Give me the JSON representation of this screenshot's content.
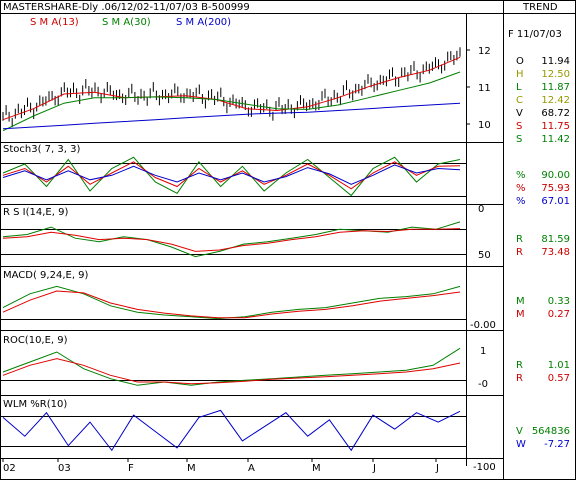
{
  "header": {
    "title": "MASTERSHARE-Dly .06/12/02-11/07/03 B-500999",
    "trend": "TREND",
    "sma13": "S M A(13)",
    "sma30": "S M A(30)",
    "sma200": "S M A(200)"
  },
  "colors": {
    "price": "#000000",
    "sma13": "#e00000",
    "sma30": "#008000",
    "sma200": "#0000cc",
    "grid": "#000000",
    "text_green": "#008000",
    "text_red": "#cc0000",
    "text_olive": "#999900",
    "text_blue": "#0000cc"
  },
  "readout": {
    "date": "F 11/07/03",
    "rows": [
      {
        "k": "O",
        "v": "11.94",
        "color": "#000000"
      },
      {
        "k": "H",
        "v": "12.50",
        "color": "#999900"
      },
      {
        "k": "L",
        "v": "11.87",
        "color": "#008000"
      },
      {
        "k": "C",
        "v": "12.42",
        "color": "#999900"
      },
      {
        "k": "V",
        "v": "68.72",
        "color": "#000000"
      },
      {
        "k": "S",
        "v": "11.75",
        "color": "#cc0000"
      },
      {
        "k": "S",
        "v": "11.42",
        "color": "#008000"
      }
    ]
  },
  "panels": {
    "stoch": {
      "label": "Stoch3( 7, 3, 3)",
      "rows": [
        {
          "k": "%",
          "v": "90.00",
          "color": "#008000"
        },
        {
          "k": "%",
          "v": "75.93",
          "color": "#cc0000"
        },
        {
          "k": "%",
          "v": "67.01",
          "color": "#0000cc"
        }
      ]
    },
    "rsi": {
      "label": "R S I(14,E, 9)",
      "rows": [
        {
          "k": "R",
          "v": "81.59",
          "color": "#008000"
        },
        {
          "k": "R",
          "v": "73.48",
          "color": "#cc0000"
        }
      ]
    },
    "macd": {
      "label": "MACD( 9,24,E, 9)",
      "rows": [
        {
          "k": "M",
          "v": "0.33",
          "color": "#008000"
        },
        {
          "k": "M",
          "v": "0.27",
          "color": "#cc0000"
        }
      ]
    },
    "roc": {
      "label": "ROC(10,E, 9)",
      "rows": [
        {
          "k": "R",
          "v": "1.01",
          "color": "#008000"
        },
        {
          "k": "R",
          "v": "0.57",
          "color": "#cc0000"
        }
      ]
    },
    "wlm": {
      "label": "WLM %R(10)",
      "rows": [
        {
          "k": "V",
          "v": "564836",
          "color": "#008000"
        },
        {
          "k": "W",
          "v": "-7.27",
          "color": "#0000cc"
        }
      ]
    }
  },
  "chart_data": [
    {
      "type": "line",
      "title": "MASTERSHARE-Dly .06/12/02-11/07/03 B-500999",
      "xlabel": "",
      "ylabel": "",
      "x_tick_labels": [
        "02",
        "03",
        "F",
        "M",
        "A",
        "M",
        "J",
        "J"
      ],
      "y_tick_labels": [
        "12",
        "11",
        "10"
      ],
      "ylim": [
        9.7,
        12.7
      ],
      "series": [
        {
          "name": "S M A(13)",
          "x": [
            0,
            10,
            20,
            30,
            40,
            50,
            60,
            70,
            80,
            90,
            100,
            110,
            120,
            130,
            140,
            150
          ],
          "values": [
            10.2,
            10.5,
            10.9,
            10.95,
            10.8,
            10.82,
            10.85,
            10.75,
            10.5,
            10.45,
            10.55,
            10.8,
            11.1,
            11.35,
            11.55,
            11.9
          ]
        },
        {
          "name": "S M A(30)",
          "x": [
            0,
            10,
            20,
            30,
            40,
            50,
            60,
            70,
            80,
            90,
            100,
            110,
            120,
            130,
            140,
            150
          ],
          "values": [
            9.9,
            10.3,
            10.65,
            10.8,
            10.8,
            10.82,
            10.8,
            10.75,
            10.62,
            10.5,
            10.48,
            10.6,
            10.8,
            11.0,
            11.2,
            11.5
          ]
        },
        {
          "name": "S M A(200)",
          "x": [
            0,
            10,
            20,
            30,
            40,
            50,
            60,
            70,
            80,
            90,
            100,
            110,
            120,
            130,
            140,
            150
          ],
          "values": [
            9.95,
            10.0,
            10.05,
            10.1,
            10.15,
            10.2,
            10.25,
            10.3,
            10.35,
            10.38,
            10.4,
            10.45,
            10.5,
            10.55,
            10.6,
            10.65
          ]
        }
      ]
    },
    {
      "type": "line",
      "title": "Stoch3( 7, 3, 3)",
      "ylim": [
        0,
        100
      ],
      "y_tick_labels": [
        "0"
      ],
      "series": [
        {
          "name": "%",
          "values": [
            60,
            80,
            30,
            90,
            20,
            70,
            95,
            40,
            15,
            85,
            30,
            75,
            20,
            60,
            90,
            50,
            10,
            70,
            95,
            40,
            80,
            90
          ]
        },
        {
          "name": "%",
          "values": [
            55,
            70,
            40,
            75,
            35,
            60,
            85,
            50,
            30,
            70,
            40,
            65,
            35,
            55,
            80,
            55,
            25,
            60,
            85,
            55,
            75,
            76
          ]
        },
        {
          "name": "%",
          "values": [
            50,
            65,
            45,
            65,
            45,
            55,
            75,
            55,
            40,
            60,
            45,
            60,
            40,
            52,
            72,
            58,
            35,
            55,
            78,
            60,
            70,
            67
          ]
        }
      ]
    },
    {
      "type": "line",
      "title": "R S I(14,E, 9)",
      "y_tick_labels": [
        "50"
      ],
      "ylim": [
        25,
        90
      ],
      "series": [
        {
          "name": "R",
          "values": [
            62,
            65,
            75,
            60,
            55,
            62,
            58,
            48,
            35,
            42,
            52,
            55,
            60,
            65,
            72,
            70,
            68,
            75,
            72,
            82
          ]
        },
        {
          "name": "R",
          "values": [
            60,
            62,
            68,
            64,
            58,
            60,
            58,
            52,
            42,
            44,
            50,
            53,
            58,
            62,
            68,
            70,
            69,
            72,
            72,
            73
          ]
        }
      ]
    },
    {
      "type": "line",
      "title": "MACD( 9,24,E, 9)",
      "y_tick_labels": [
        "-0.00"
      ],
      "ylim": [
        -0.1,
        0.4
      ],
      "series": [
        {
          "name": "M",
          "values": [
            0.1,
            0.25,
            0.33,
            0.25,
            0.12,
            0.05,
            0.02,
            0.0,
            -0.02,
            0.0,
            0.05,
            0.08,
            0.1,
            0.15,
            0.2,
            0.22,
            0.25,
            0.33
          ]
        },
        {
          "name": "M",
          "values": [
            0.05,
            0.18,
            0.28,
            0.26,
            0.15,
            0.08,
            0.04,
            0.01,
            -0.01,
            -0.01,
            0.03,
            0.06,
            0.08,
            0.12,
            0.17,
            0.2,
            0.23,
            0.27
          ]
        }
      ]
    },
    {
      "type": "line",
      "title": "ROC(10,E, 9)",
      "y_tick_labels": [
        "1",
        "-0"
      ],
      "ylim": [
        -0.3,
        1.2
      ],
      "series": [
        {
          "name": "R",
          "values": [
            0.3,
            0.6,
            0.9,
            0.4,
            0.1,
            -0.1,
            0.0,
            -0.1,
            0.0,
            0.05,
            0.1,
            0.15,
            0.2,
            0.25,
            0.3,
            0.35,
            0.5,
            1.01
          ]
        },
        {
          "name": "R",
          "values": [
            0.2,
            0.5,
            0.7,
            0.5,
            0.2,
            0.0,
            0.0,
            -0.05,
            -0.02,
            0.02,
            0.08,
            0.12,
            0.16,
            0.2,
            0.25,
            0.3,
            0.4,
            0.57
          ]
        }
      ]
    },
    {
      "type": "line",
      "title": "WLM %R(10)",
      "y_tick_labels": [
        "-100"
      ],
      "ylim": [
        -100,
        0
      ],
      "series": [
        {
          "name": "W",
          "values": [
            -20,
            -60,
            -10,
            -80,
            -30,
            -90,
            -15,
            -50,
            -85,
            -20,
            -5,
            -70,
            -40,
            -10,
            -60,
            -25,
            -90,
            -15,
            -45,
            -10,
            -30,
            -7
          ]
        }
      ]
    }
  ]
}
